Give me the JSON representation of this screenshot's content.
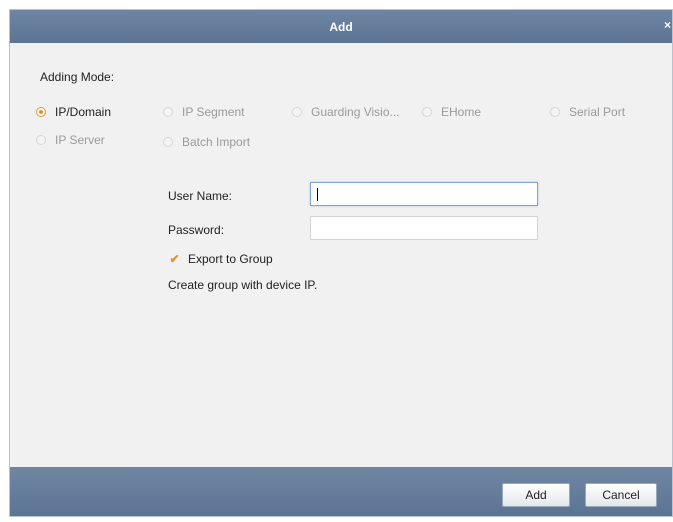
{
  "dialog": {
    "title": "Add",
    "close_glyph": "×"
  },
  "adding_mode": {
    "label": "Adding Mode:",
    "options": [
      {
        "label": "IP/Domain",
        "state": "checked"
      },
      {
        "label": "IP Segment",
        "state": "disabled"
      },
      {
        "label": "Guarding Visio...",
        "state": "disabled"
      },
      {
        "label": "EHome",
        "state": "disabled"
      },
      {
        "label": "Serial Port",
        "state": "disabled"
      },
      {
        "label": "IP Server",
        "state": "disabled"
      },
      {
        "label": "Batch Import",
        "state": "disabled"
      }
    ]
  },
  "form": {
    "username_label": "User Name:",
    "username_value": "",
    "password_label": "Password:",
    "password_value": "",
    "export_label": "Export to Group",
    "export_checked": true,
    "check_glyph": "✔",
    "hint": "Create group with device IP."
  },
  "footer": {
    "add_label": "Add",
    "cancel_label": "Cancel"
  },
  "colors": {
    "header": "#5c7493",
    "accent": "#e0922c",
    "focus_border": "#7ea6d9"
  }
}
